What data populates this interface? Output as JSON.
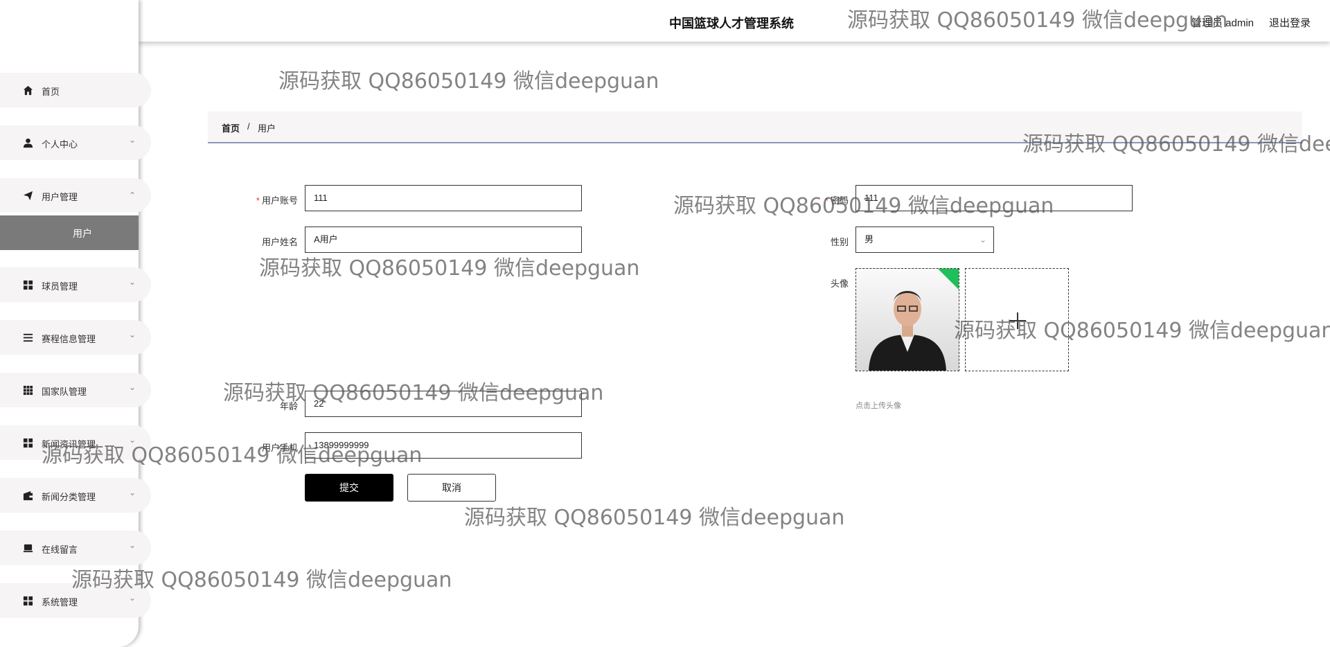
{
  "header": {
    "title": "中国篮球人才管理系统",
    "user": "管理员 admin",
    "logout": "退出登录"
  },
  "sidebar": {
    "items": [
      {
        "label": "首页",
        "icon": "home-icon",
        "chevron": ""
      },
      {
        "label": "个人中心",
        "icon": "user-icon",
        "chevron": "⌄"
      },
      {
        "label": "用户管理",
        "icon": "send-icon",
        "chevron": "⌃"
      },
      {
        "label": "球员管理",
        "icon": "grid-icon",
        "chevron": "⌄"
      },
      {
        "label": "赛程信息管理",
        "icon": "list-icon",
        "chevron": "⌄"
      },
      {
        "label": "国家队管理",
        "icon": "apps-icon",
        "chevron": "⌄"
      },
      {
        "label": "新闻资讯管理",
        "icon": "grid-icon",
        "chevron": "⌄"
      },
      {
        "label": "新闻分类管理",
        "icon": "wallet-icon",
        "chevron": "⌄"
      },
      {
        "label": "在线留言",
        "icon": "message-icon",
        "chevron": "⌄"
      },
      {
        "label": "系统管理",
        "icon": "grid-icon",
        "chevron": "⌄"
      }
    ],
    "submenu_active": "用户"
  },
  "breadcrumb": {
    "home": "首页",
    "sep": "/",
    "current": "用户"
  },
  "form": {
    "account_label": "用户账号",
    "account_value": "111",
    "password_label": "密码",
    "password_value": "111",
    "name_label": "用户姓名",
    "name_value": "A用户",
    "gender_label": "性别",
    "gender_value": "男",
    "avatar_label": "头像",
    "avatar_hint": "点击上传头像",
    "age_label": "年龄",
    "age_value": "22",
    "phone_label": "用户手机",
    "phone_value": "13899999999",
    "required_mark": "*"
  },
  "buttons": {
    "submit": "提交",
    "cancel": "取消"
  },
  "watermark_text": "源码获取 QQ86050149 微信deepguan",
  "colors": {
    "active_submenu": "#7a7a7a",
    "submit_bg": "#000000",
    "required": "#ee3333",
    "avatar_corner": "#1fc05a"
  }
}
